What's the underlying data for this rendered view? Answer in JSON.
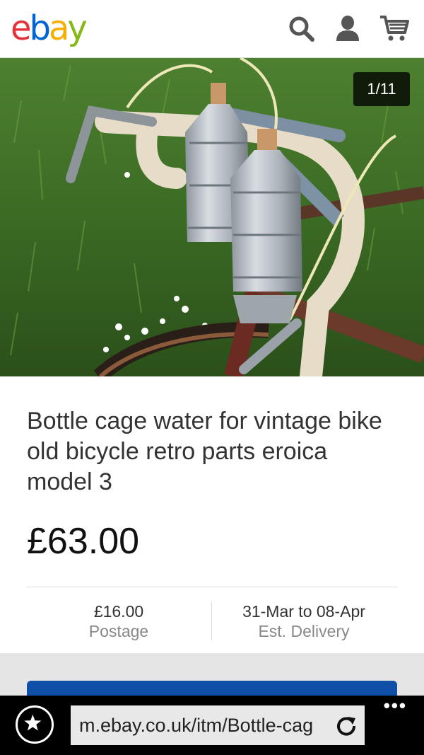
{
  "app": {
    "logo_letters": [
      {
        "char": "e",
        "color": "#e53238"
      },
      {
        "char": "b",
        "color": "#0064d2"
      },
      {
        "char": "a",
        "color": "#f5af02"
      },
      {
        "char": "y",
        "color": "#86b817"
      }
    ]
  },
  "header": {
    "icons": [
      "search-icon",
      "account-icon",
      "cart-icon"
    ],
    "icon_color": "#555555"
  },
  "gallery": {
    "counter": "1/11"
  },
  "listing": {
    "title": "Bottle cage water for vintage bike old bicycle retro parts eroica model 3",
    "price": "£63.00",
    "postage_value": "£16.00",
    "postage_label": "Postage",
    "delivery_value": "31-Mar to 08-Apr",
    "delivery_label": "Est. Delivery",
    "accent_color": "#0f4fa8"
  },
  "browser": {
    "url": "m.ebay.co.uk/itm/Bottle-cag",
    "more_label": "•••",
    "icons": [
      "favorites-star-icon",
      "refresh-icon"
    ]
  }
}
